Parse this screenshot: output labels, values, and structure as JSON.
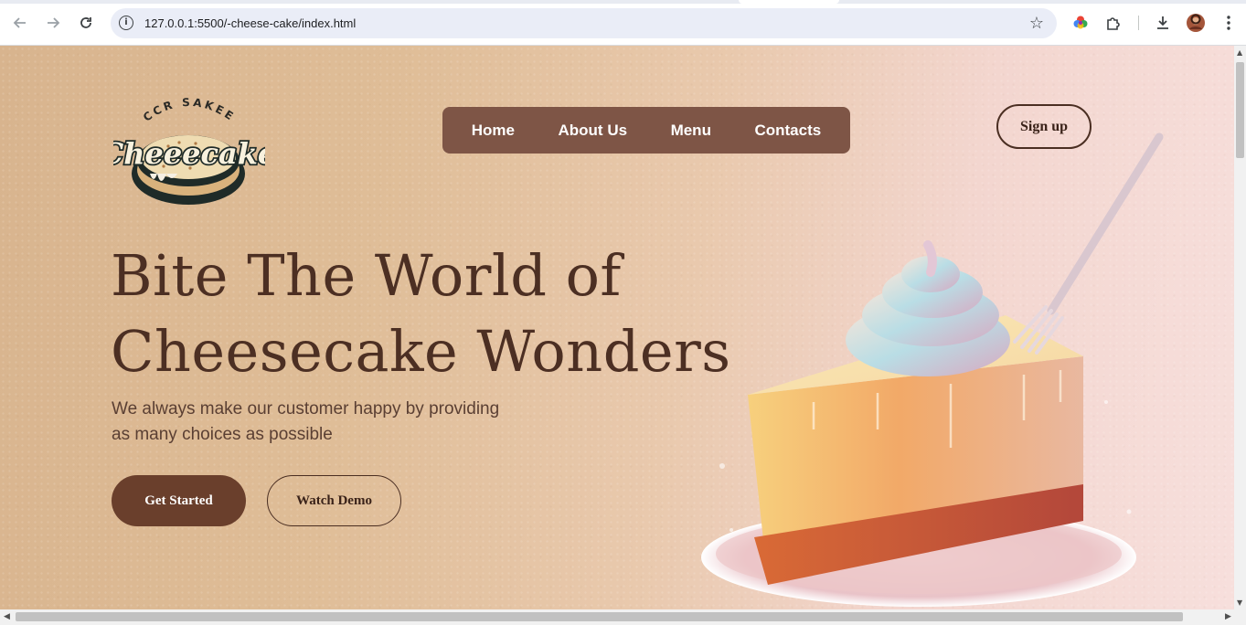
{
  "browser": {
    "url": "127.0.0.1:5500/-cheese-cake/index.html",
    "back_icon": "arrow-left-icon",
    "forward_icon": "arrow-right-icon",
    "reload_icon": "reload-icon",
    "site_info_icon": "info-icon",
    "bookmark_icon": "star-icon"
  },
  "logo": {
    "arc_text": "CCR SAKEE",
    "wordmark": "Cheeecake"
  },
  "nav": {
    "items": [
      {
        "label": "Home"
      },
      {
        "label": "About Us"
      },
      {
        "label": "Menu"
      },
      {
        "label": "Contacts"
      }
    ],
    "signup_label": "Sign up"
  },
  "hero": {
    "headline_line1": "Bite The World of",
    "headline_line2": "Cheesecake Wonders",
    "subtext_line1": "We always make our customer happy by providing",
    "subtext_line2": "as many choices as possible",
    "primary_button": "Get Started",
    "secondary_button": "Watch Demo"
  },
  "colors": {
    "brand_brown": "#6a3f2c",
    "nav_bg": "#7e5546",
    "text_dark": "#4c2f23"
  }
}
